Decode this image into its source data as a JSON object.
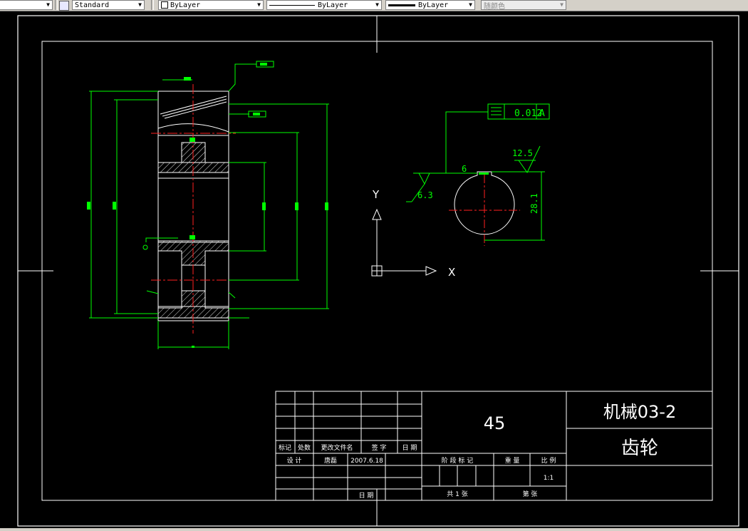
{
  "toolbar": {
    "text_style": "Standard",
    "layer": "ByLayer",
    "linetype": "ByLayer",
    "lineweight": "ByLayer",
    "color": "随颜色"
  },
  "dimensions": {
    "key_width": "6",
    "roughness_top": "12.5",
    "roughness_left": "6.3",
    "keyway_depth": "28.1",
    "tolerance_value": "0.012",
    "tolerance_datum": "A"
  },
  "ucs": {
    "x_label": "X",
    "y_label": "Y"
  },
  "title_block": {
    "material": "45",
    "drawing_number": "机械03-2",
    "part_name": "齿轮",
    "scale": "1:1",
    "headers": {
      "mark": "标记",
      "count": "处数",
      "change_doc": "更改文件名",
      "signature": "签  字",
      "date": "日 期",
      "design": "设  计",
      "designer": "唐磊",
      "design_date": "2007.6.18",
      "stage_mark": "阶 段 标 记",
      "weight": "重  量",
      "scale_label": "比 例",
      "total_sheets": "共  1  张",
      "sheet_no": "第     张",
      "approve_date": "日  期"
    }
  },
  "colors": {
    "background": "#000000",
    "border": "#ffffff",
    "dimension": "#00ff00",
    "centerline": "#ff0000",
    "hatch": "#e0e0e0",
    "toolbar": "#d4d0c8"
  }
}
